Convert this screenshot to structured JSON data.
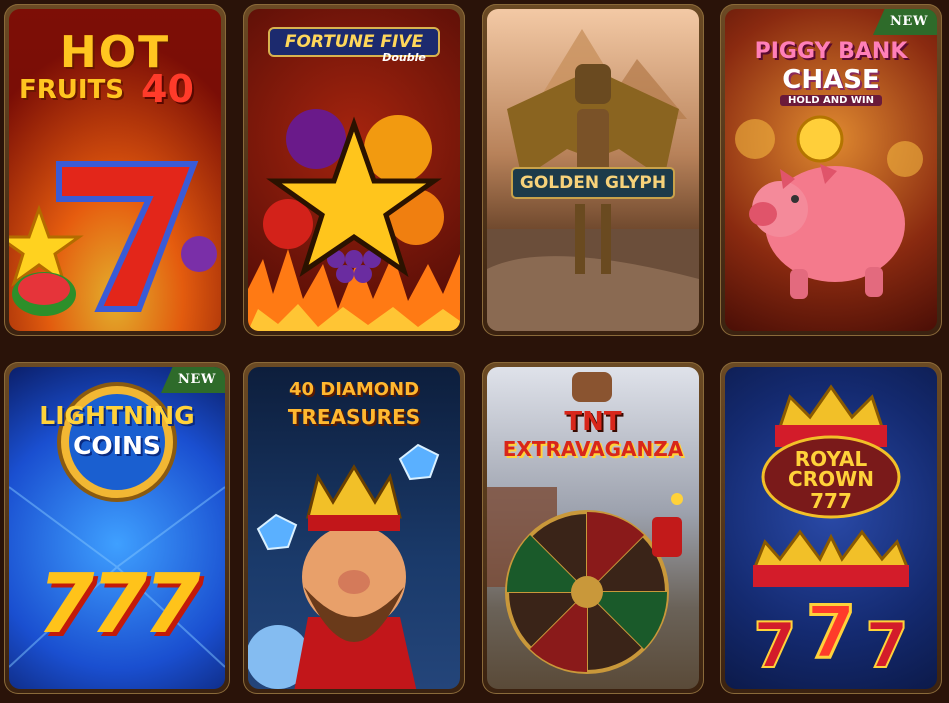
{
  "games": [
    {
      "title_line1": "HOT",
      "title_line2": "FRUITS",
      "title_num": "40",
      "badge": ""
    },
    {
      "title_line1": "FORTUNE FIVE",
      "title_sub": "Double",
      "badge": ""
    },
    {
      "title_line1": "GOLDEN GLYPH",
      "badge": ""
    },
    {
      "title_line1": "PIGGY BANK",
      "title_line2": "CHASE",
      "title_sub": "HOLD AND WIN",
      "badge": "NEW"
    },
    {
      "title_line1": "LIGHTNING",
      "title_line2": "COINS",
      "title_num": "777",
      "badge": "NEW"
    },
    {
      "title_line1": "40 DIAMOND",
      "title_line2": "TREASURES",
      "badge": ""
    },
    {
      "title_line1": "TNT",
      "title_line2": "EXTRAVAGANZA",
      "badge": ""
    },
    {
      "title_line1": "ROYAL",
      "title_line2": "CROWN",
      "title_num": "777",
      "badge": ""
    }
  ],
  "colors": {
    "background": "#2a1309",
    "frame": "#8a6a3a",
    "new_badge": "#2e6b2a"
  },
  "icons": [
    "seven-icon",
    "star-icon",
    "fruit-icon",
    "winged-statue-icon",
    "piggy-bank-icon",
    "coin-icon",
    "crown-icon",
    "diamond-icon",
    "king-icon",
    "dynamite-icon",
    "wheel-icon"
  ]
}
